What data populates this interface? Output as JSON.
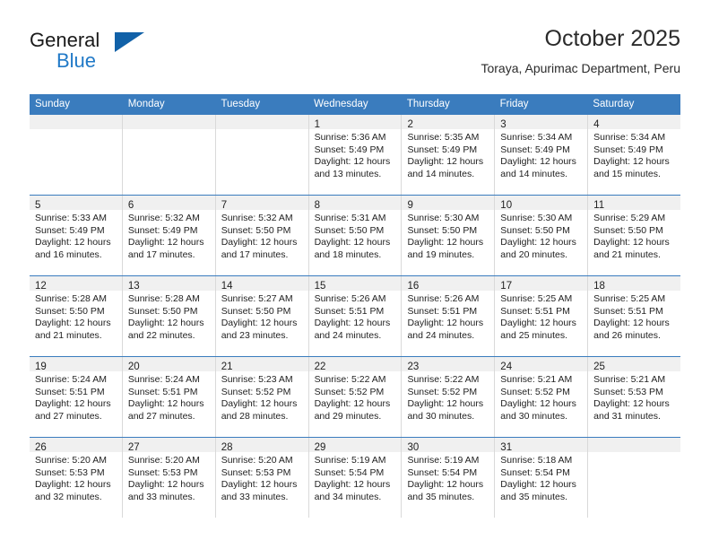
{
  "brand": {
    "name_part1": "General",
    "name_part2": "Blue",
    "logo_icon": "triangle-logo-icon"
  },
  "header": {
    "title": "October 2025",
    "subtitle": "Toraya, Apurimac Department, Peru"
  },
  "colors": {
    "header_blue": "#3a7cbe",
    "brand_blue": "#2079c7",
    "logo_blue": "#1161a8",
    "day_bar_gray": "#f0f0f0",
    "cell_border": "#d9d9d9"
  },
  "weekdays": [
    "Sunday",
    "Monday",
    "Tuesday",
    "Wednesday",
    "Thursday",
    "Friday",
    "Saturday"
  ],
  "weeks": [
    [
      {
        "day": "",
        "empty": true,
        "lines": []
      },
      {
        "day": "",
        "empty": true,
        "lines": []
      },
      {
        "day": "",
        "empty": true,
        "lines": []
      },
      {
        "day": "1",
        "empty": false,
        "lines": [
          "Sunrise: 5:36 AM",
          "Sunset: 5:49 PM",
          "Daylight: 12 hours",
          "and 13 minutes."
        ]
      },
      {
        "day": "2",
        "empty": false,
        "lines": [
          "Sunrise: 5:35 AM",
          "Sunset: 5:49 PM",
          "Daylight: 12 hours",
          "and 14 minutes."
        ]
      },
      {
        "day": "3",
        "empty": false,
        "lines": [
          "Sunrise: 5:34 AM",
          "Sunset: 5:49 PM",
          "Daylight: 12 hours",
          "and 14 minutes."
        ]
      },
      {
        "day": "4",
        "empty": false,
        "lines": [
          "Sunrise: 5:34 AM",
          "Sunset: 5:49 PM",
          "Daylight: 12 hours",
          "and 15 minutes."
        ]
      }
    ],
    [
      {
        "day": "5",
        "empty": false,
        "lines": [
          "Sunrise: 5:33 AM",
          "Sunset: 5:49 PM",
          "Daylight: 12 hours",
          "and 16 minutes."
        ]
      },
      {
        "day": "6",
        "empty": false,
        "lines": [
          "Sunrise: 5:32 AM",
          "Sunset: 5:49 PM",
          "Daylight: 12 hours",
          "and 17 minutes."
        ]
      },
      {
        "day": "7",
        "empty": false,
        "lines": [
          "Sunrise: 5:32 AM",
          "Sunset: 5:50 PM",
          "Daylight: 12 hours",
          "and 17 minutes."
        ]
      },
      {
        "day": "8",
        "empty": false,
        "lines": [
          "Sunrise: 5:31 AM",
          "Sunset: 5:50 PM",
          "Daylight: 12 hours",
          "and 18 minutes."
        ]
      },
      {
        "day": "9",
        "empty": false,
        "lines": [
          "Sunrise: 5:30 AM",
          "Sunset: 5:50 PM",
          "Daylight: 12 hours",
          "and 19 minutes."
        ]
      },
      {
        "day": "10",
        "empty": false,
        "lines": [
          "Sunrise: 5:30 AM",
          "Sunset: 5:50 PM",
          "Daylight: 12 hours",
          "and 20 minutes."
        ]
      },
      {
        "day": "11",
        "empty": false,
        "lines": [
          "Sunrise: 5:29 AM",
          "Sunset: 5:50 PM",
          "Daylight: 12 hours",
          "and 21 minutes."
        ]
      }
    ],
    [
      {
        "day": "12",
        "empty": false,
        "lines": [
          "Sunrise: 5:28 AM",
          "Sunset: 5:50 PM",
          "Daylight: 12 hours",
          "and 21 minutes."
        ]
      },
      {
        "day": "13",
        "empty": false,
        "lines": [
          "Sunrise: 5:28 AM",
          "Sunset: 5:50 PM",
          "Daylight: 12 hours",
          "and 22 minutes."
        ]
      },
      {
        "day": "14",
        "empty": false,
        "lines": [
          "Sunrise: 5:27 AM",
          "Sunset: 5:50 PM",
          "Daylight: 12 hours",
          "and 23 minutes."
        ]
      },
      {
        "day": "15",
        "empty": false,
        "lines": [
          "Sunrise: 5:26 AM",
          "Sunset: 5:51 PM",
          "Daylight: 12 hours",
          "and 24 minutes."
        ]
      },
      {
        "day": "16",
        "empty": false,
        "lines": [
          "Sunrise: 5:26 AM",
          "Sunset: 5:51 PM",
          "Daylight: 12 hours",
          "and 24 minutes."
        ]
      },
      {
        "day": "17",
        "empty": false,
        "lines": [
          "Sunrise: 5:25 AM",
          "Sunset: 5:51 PM",
          "Daylight: 12 hours",
          "and 25 minutes."
        ]
      },
      {
        "day": "18",
        "empty": false,
        "lines": [
          "Sunrise: 5:25 AM",
          "Sunset: 5:51 PM",
          "Daylight: 12 hours",
          "and 26 minutes."
        ]
      }
    ],
    [
      {
        "day": "19",
        "empty": false,
        "lines": [
          "Sunrise: 5:24 AM",
          "Sunset: 5:51 PM",
          "Daylight: 12 hours",
          "and 27 minutes."
        ]
      },
      {
        "day": "20",
        "empty": false,
        "lines": [
          "Sunrise: 5:24 AM",
          "Sunset: 5:51 PM",
          "Daylight: 12 hours",
          "and 27 minutes."
        ]
      },
      {
        "day": "21",
        "empty": false,
        "lines": [
          "Sunrise: 5:23 AM",
          "Sunset: 5:52 PM",
          "Daylight: 12 hours",
          "and 28 minutes."
        ]
      },
      {
        "day": "22",
        "empty": false,
        "lines": [
          "Sunrise: 5:22 AM",
          "Sunset: 5:52 PM",
          "Daylight: 12 hours",
          "and 29 minutes."
        ]
      },
      {
        "day": "23",
        "empty": false,
        "lines": [
          "Sunrise: 5:22 AM",
          "Sunset: 5:52 PM",
          "Daylight: 12 hours",
          "and 30 minutes."
        ]
      },
      {
        "day": "24",
        "empty": false,
        "lines": [
          "Sunrise: 5:21 AM",
          "Sunset: 5:52 PM",
          "Daylight: 12 hours",
          "and 30 minutes."
        ]
      },
      {
        "day": "25",
        "empty": false,
        "lines": [
          "Sunrise: 5:21 AM",
          "Sunset: 5:53 PM",
          "Daylight: 12 hours",
          "and 31 minutes."
        ]
      }
    ],
    [
      {
        "day": "26",
        "empty": false,
        "lines": [
          "Sunrise: 5:20 AM",
          "Sunset: 5:53 PM",
          "Daylight: 12 hours",
          "and 32 minutes."
        ]
      },
      {
        "day": "27",
        "empty": false,
        "lines": [
          "Sunrise: 5:20 AM",
          "Sunset: 5:53 PM",
          "Daylight: 12 hours",
          "and 33 minutes."
        ]
      },
      {
        "day": "28",
        "empty": false,
        "lines": [
          "Sunrise: 5:20 AM",
          "Sunset: 5:53 PM",
          "Daylight: 12 hours",
          "and 33 minutes."
        ]
      },
      {
        "day": "29",
        "empty": false,
        "lines": [
          "Sunrise: 5:19 AM",
          "Sunset: 5:54 PM",
          "Daylight: 12 hours",
          "and 34 minutes."
        ]
      },
      {
        "day": "30",
        "empty": false,
        "lines": [
          "Sunrise: 5:19 AM",
          "Sunset: 5:54 PM",
          "Daylight: 12 hours",
          "and 35 minutes."
        ]
      },
      {
        "day": "31",
        "empty": false,
        "lines": [
          "Sunrise: 5:18 AM",
          "Sunset: 5:54 PM",
          "Daylight: 12 hours",
          "and 35 minutes."
        ]
      },
      {
        "day": "",
        "empty": true,
        "lines": []
      }
    ]
  ]
}
